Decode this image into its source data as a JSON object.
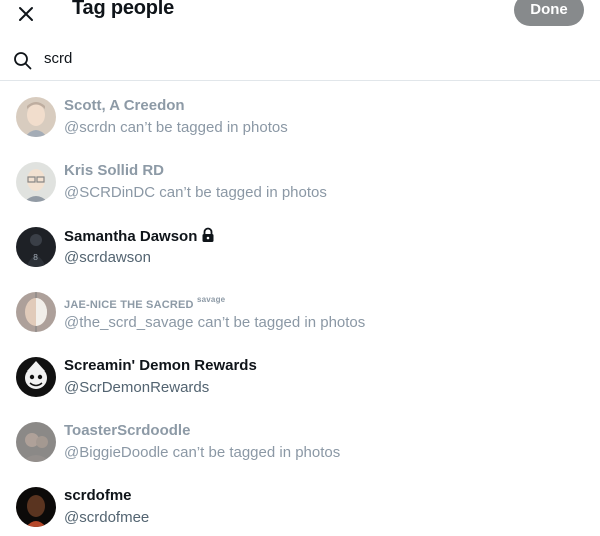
{
  "header": {
    "title": "Tag people",
    "done_label": "Done"
  },
  "search": {
    "value": "scrd"
  },
  "results": [
    {
      "name": "Scott, A Creedon",
      "handle": "@scrdn can’t be tagged in photos",
      "taggable": false
    },
    {
      "name": "Kris Sollid RD",
      "handle": "@SCRDinDC can’t be tagged in photos",
      "taggable": false
    },
    {
      "name": "Samantha Dawson",
      "handle": "@scrdawson",
      "taggable": true,
      "protected": true
    },
    {
      "name": "JAE-NICE THE SACRED",
      "name_extra": "savage",
      "handle": "@the_scrd_savage can’t be tagged in photos",
      "taggable": false
    },
    {
      "name": "Screamin' Demon Rewards",
      "handle": "@ScrDemonRewards",
      "taggable": true
    },
    {
      "name": "ToasterScrdoodle",
      "handle": "@BiggieDoodle can’t be tagged in photos",
      "taggable": false
    },
    {
      "name": "scrdofme",
      "handle": "@scrdofmee",
      "taggable": true
    }
  ]
}
